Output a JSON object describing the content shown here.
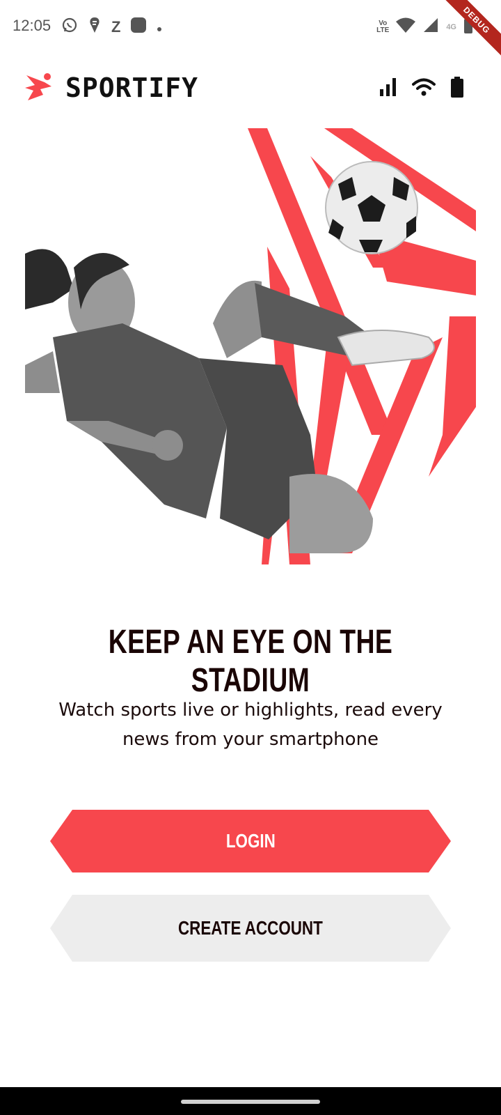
{
  "status_bar": {
    "time": "12:05",
    "z_label": "Z",
    "lte_top": "Vo",
    "lte_bottom": "LTE",
    "network_label": "4G",
    "debug_label": "DEBUG"
  },
  "app": {
    "brand": "SPORTIFY",
    "brand_color": "#f7474d"
  },
  "hero": {
    "accent_color": "#f7474d"
  },
  "onboarding": {
    "headline": "KEEP AN EYE ON THE STADIUM",
    "subtitle": "Watch sports live or highlights, read every news from your smartphone"
  },
  "buttons": {
    "login_label": "LOGIN",
    "create_account_label": "CREATE ACCOUNT"
  },
  "icons": {
    "header": [
      "signal-bars-icon",
      "wifi-icon",
      "battery-icon"
    ],
    "status": [
      "whatsapp-icon",
      "swiggy-icon",
      "zomato-icon",
      "app-icon",
      "wifi-icon",
      "cell-signal-icon",
      "battery-icon"
    ]
  }
}
